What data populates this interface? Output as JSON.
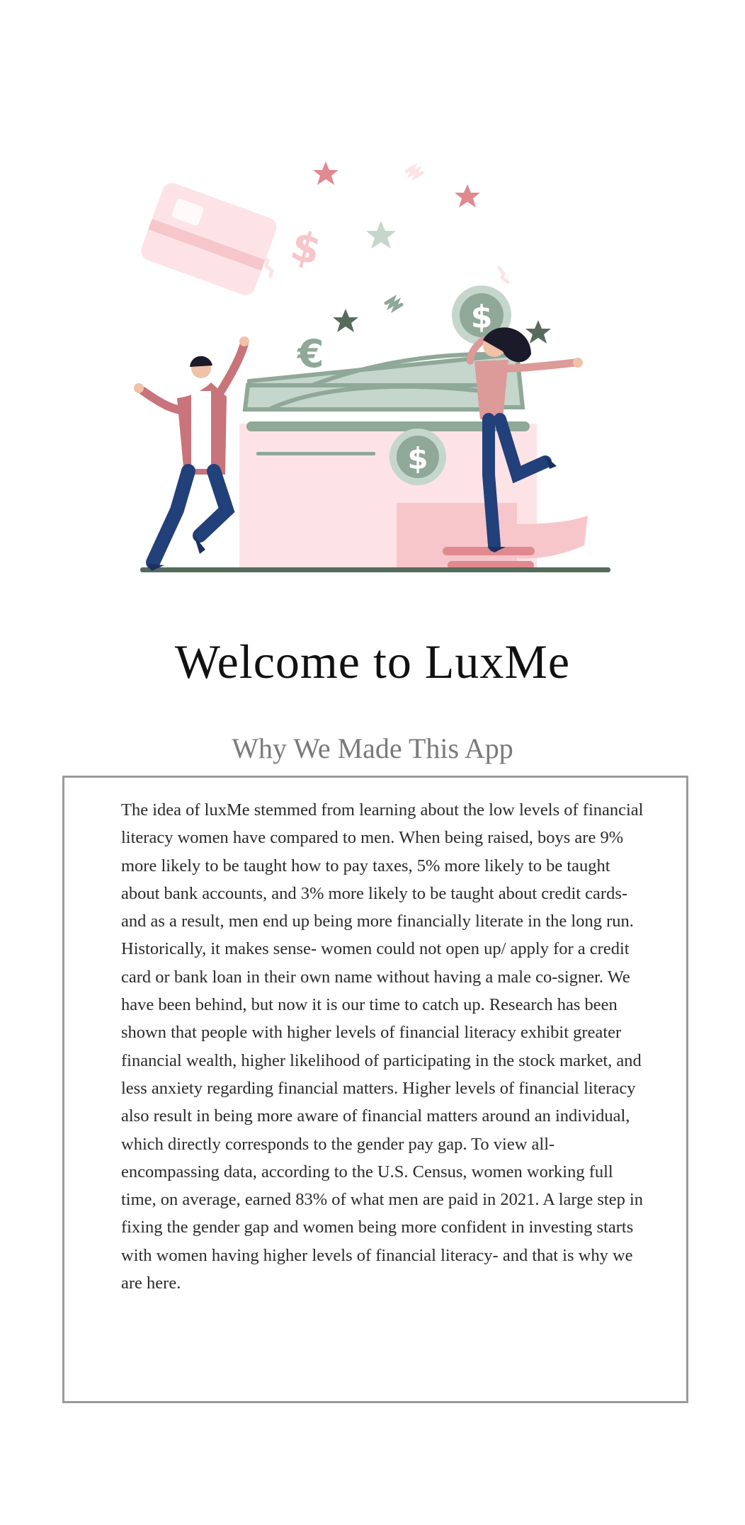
{
  "welcome": {
    "title": "Welcome to LuxMe",
    "section_heading": "Why We Made This App",
    "body": "The idea of luxMe stemmed from learning about the low levels of financial literacy women have compared to men. When being raised, boys are 9% more likely to be taught how to pay taxes, 5% more likely to be taught about bank accounts, and 3% more likely to be taught about credit cards- and as a result, men end up being more financially literate in the long run. Historically, it makes sense- women could not open up/ apply for a credit card or bank loan in their own name without having a male co-signer. We have been behind, but now it is our time to catch up. Research has been shown that people with higher levels of financial literacy exhibit greater financial wealth, higher likelihood of participating in the stock market, and less anxiety regarding financial matters. Higher levels of financial literacy also result in being more aware of financial matters around an individual, which directly corresponds to the gender pay gap. To view all-encompassing data, according to the U.S. Census, women working full time, on average, earned 83% of what men are paid in 2021. A large step in fixing the gender gap and women being more confident in investing starts with women having higher levels of financial literacy- and that is why we are here."
  },
  "illustration": {
    "name": "financial-celebration-illustration",
    "symbols": {
      "dollar": "$",
      "euro": "€"
    },
    "colors": {
      "pink_light": "#fde3e6",
      "pink": "#f7c6cb",
      "rose": "#e0898e",
      "sage_light": "#c5d6cc",
      "sage": "#8fa898",
      "sage_dark": "#566b5c",
      "navy": "#22407a",
      "hair": "#1a1a2a"
    }
  }
}
